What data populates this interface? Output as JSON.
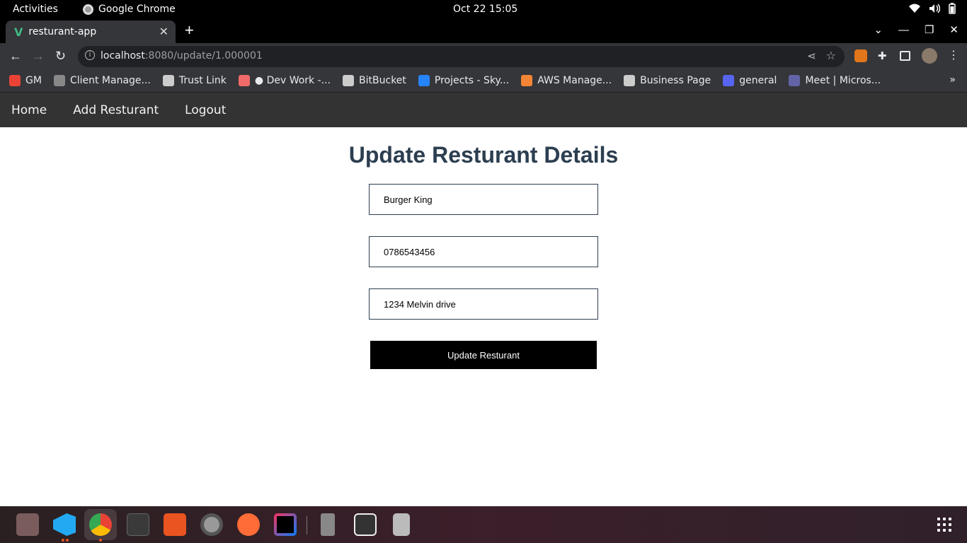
{
  "system_bar": {
    "activities": "Activities",
    "app_name": "Google Chrome",
    "clock": "Oct 22  15:05",
    "tray_icons": [
      "wifi-icon",
      "volume-icon",
      "battery-icon"
    ]
  },
  "browser": {
    "tab_title": "resturant-app",
    "tab_favicon": "vue-logo-icon",
    "url_host": "localhost",
    "url_rest": ":8080/update/1.000001",
    "extension_icons": [
      "metamask-icon",
      "puzzle-icon",
      "sidepanel-icon",
      "profile-avatar"
    ],
    "bookmarks": [
      {
        "label": "GM",
        "icon": "gmail-icon",
        "color": "#ea4335"
      },
      {
        "label": "Client Manage...",
        "icon": "globe-icon",
        "color": "#888888"
      },
      {
        "label": "Trust Link",
        "icon": "trustlink-icon",
        "color": "#cccccc"
      },
      {
        "label": "● Dev Work -...",
        "icon": "asana-icon",
        "color": "#f06a6a"
      },
      {
        "label": "BitBucket",
        "icon": "folder-icon",
        "color": "#cccccc"
      },
      {
        "label": "Projects - Sky...",
        "icon": "jira-icon",
        "color": "#2684ff"
      },
      {
        "label": "AWS Manage...",
        "icon": "aws-icon",
        "color": "#f58536"
      },
      {
        "label": "Business Page",
        "icon": "folder-icon",
        "color": "#cccccc"
      },
      {
        "label": "general",
        "icon": "discord-icon",
        "color": "#5865f2"
      },
      {
        "label": "Meet | Micros...",
        "icon": "teams-icon",
        "color": "#6264a7"
      }
    ]
  },
  "app": {
    "nav": [
      "Home",
      "Add Resturant",
      "Logout"
    ],
    "heading": "Update Resturant Details",
    "fields": {
      "name": "Burger King",
      "contact": "0786543456",
      "address": "1234 Melvin drive"
    },
    "submit_label": "Update Resturant"
  },
  "dock": {
    "apps": [
      "files-icon",
      "vscode-icon",
      "chrome-icon",
      "terminal-icon",
      "software-store-icon",
      "settings-icon",
      "postman-icon",
      "intellij-icon",
      "phone-icon",
      "screenshot-icon",
      "trash-icon"
    ],
    "show_apps": "show-applications-icon"
  }
}
